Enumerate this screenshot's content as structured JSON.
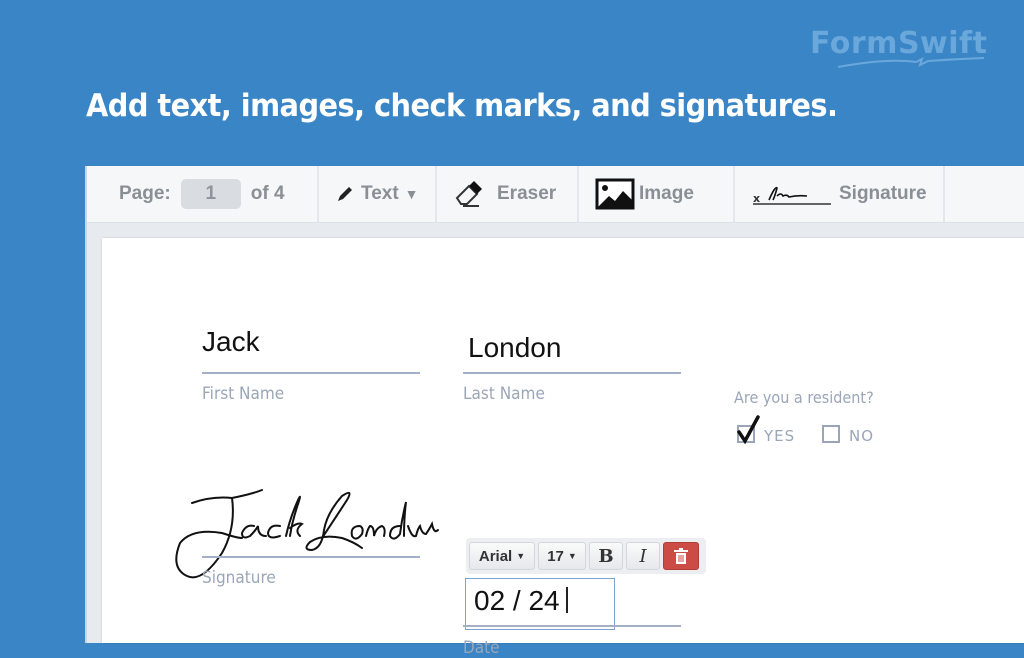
{
  "brand": {
    "logo_text": "FormSwift"
  },
  "headline": "Add text, images, check marks, and signatures.",
  "toolbar": {
    "page_label": "Page:",
    "page_value": "1",
    "page_total": "of 4",
    "text_label": "Text",
    "text_icon": "pencil-icon",
    "eraser_label": "Eraser",
    "eraser_icon": "eraser-icon",
    "image_label": "Image",
    "image_icon": "image-icon",
    "signature_label": "Signature",
    "signature_icon": "signature-icon"
  },
  "form": {
    "first_name": {
      "value": "Jack",
      "label": "First Name"
    },
    "last_name": {
      "value": "London",
      "label": "Last Name"
    },
    "resident": {
      "question": "Are you a resident?",
      "options": [
        {
          "label": "YES",
          "checked": true
        },
        {
          "label": "NO",
          "checked": false
        }
      ]
    },
    "signature": {
      "value": "Jack London",
      "label": "Signature"
    },
    "date": {
      "value": "02 / 24",
      "label": "Date"
    }
  },
  "format_toolbar": {
    "font": "Arial",
    "size": "17",
    "bold": "B",
    "italic": "I",
    "delete_icon": "trash-icon",
    "delete_color": "#cd4b45"
  },
  "colors": {
    "background": "#3a85c6",
    "label": "#9aa6b8",
    "toolbar": "#f5f7f9"
  }
}
